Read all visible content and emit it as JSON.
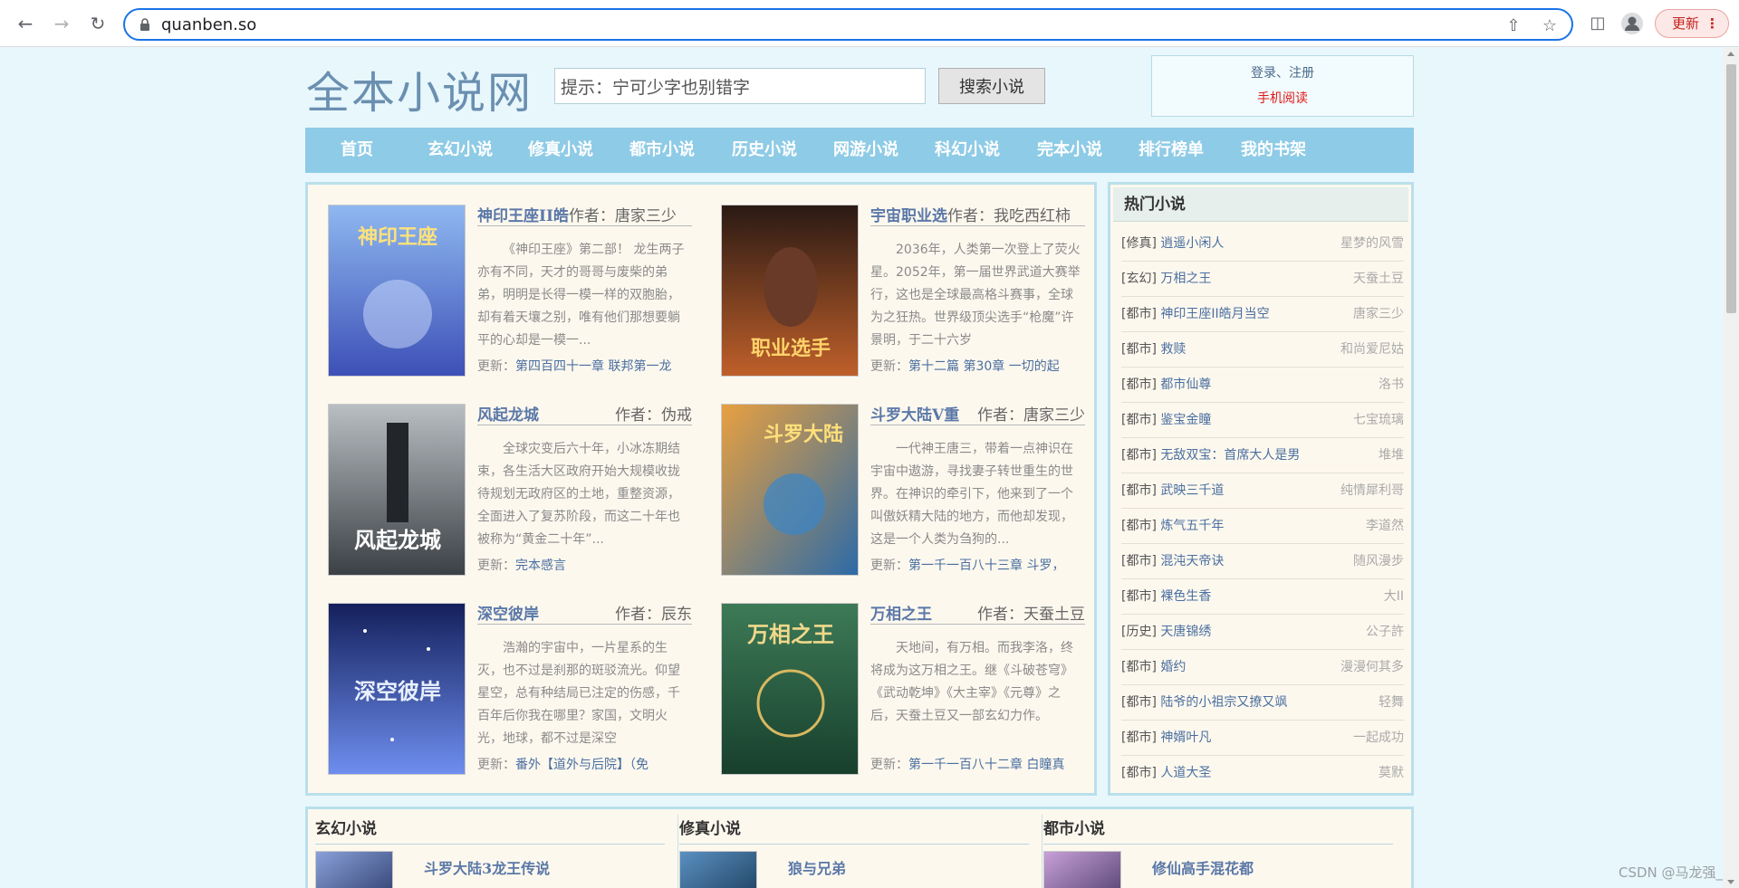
{
  "browser": {
    "url": "quanben.so",
    "update_label": "更新"
  },
  "header": {
    "site_title": "全本小说网",
    "search_value": "提示：宁可少字也别错字",
    "search_button": "搜索小说",
    "login_links": "登录、注册",
    "mobile_link": "手机阅读"
  },
  "nav": [
    {
      "label": "首页"
    },
    {
      "label": "玄幻小说"
    },
    {
      "label": "修真小说"
    },
    {
      "label": "都市小说"
    },
    {
      "label": "历史小说"
    },
    {
      "label": "网游小说"
    },
    {
      "label": "科幻小说"
    },
    {
      "label": "完本小说"
    },
    {
      "label": "排行榜单"
    },
    {
      "label": "我的书架"
    }
  ],
  "featured": [
    {
      "title": "神印王座II皓",
      "author": "作者：唐家三少",
      "desc": "《神印王座》第二部！ 龙生两子亦有不同，天才的哥哥与废柴的弟弟，明明是长得一模一样的双胞胎，却有着天壤之别，唯有他们那想要躺平的心却是一模一...",
      "update_label": "更新：",
      "update": "第四百四十一章 联邦第一龙",
      "cover_title": "神印王座",
      "cover_colors": [
        "#3c4fb6",
        "#8fb8f0"
      ]
    },
    {
      "title": "宇宙职业选",
      "author": "作者：我吃西红柿",
      "desc": "2036年，人类第一次登上了荧火星。2052年，第一届世界武道大赛举行，这也是全球最高格斗赛事，全球为之狂热。世界级顶尖选手“枪魔”许景明，于二十六岁",
      "update_label": "更新：",
      "update": "第十二篇 第30章 一切的起",
      "cover_title": "职业选手",
      "cover_colors": [
        "#2a1a14",
        "#c0602a"
      ]
    },
    {
      "title": "风起龙城",
      "author": "作者：伪戒",
      "desc": "全球灾变后六十年，小冰冻期结束，各生活大区政府开始大规模收拢待规划无政府区的土地，重整资源，全面进入了复苏阶段，而这二十年也被称为“黄金二十年”...",
      "update_label": "更新：",
      "update": "完本感言",
      "cover_title": "风起龙城",
      "cover_colors": [
        "#3a3f44",
        "#b9bec3"
      ]
    },
    {
      "title": "斗罗大陆V重",
      "author": "作者：唐家三少",
      "desc": "一代神王唐三，带着一点神识在宇宙中遨游，寻找妻子转世重生的世界。在神识的牵引下，他来到了一个叫傲妖精大陆的地方，而他却发现，这是一个人类为刍狗的...",
      "update_label": "更新：",
      "update": "第一千一百八十三章 斗罗，",
      "cover_title": "斗罗大陆",
      "cover_colors": [
        "#2b6aa8",
        "#e8a040"
      ]
    },
    {
      "title": "深空彼岸",
      "author": "作者：辰东",
      "desc": "浩瀚的宇宙中，一片星系的生灭，也不过是刹那的斑驳流光。仰望星空，总有种结局已注定的伤感，千百年后你我在哪里？家国，文明火光，地球，都不过是深空",
      "update_label": "更新：",
      "update": "番外【道外与后院】（免",
      "cover_title": "深空彼岸",
      "cover_colors": [
        "#14205c",
        "#6f8ff0"
      ]
    },
    {
      "title": "万相之王",
      "author": "作者：天蚕土豆",
      "desc": "天地间，有万相。而我李洛，终将成为这万相之王。继《斗破苍穹》《武动乾坤》《大主宰》《元尊》之后，天蚕土豆又一部玄幻力作。",
      "update_label": "更新：",
      "update": "第一千一百八十二章 白瞳真",
      "cover_title": "万相之王",
      "cover_colors": [
        "#173f2c",
        "#3d7a57"
      ]
    }
  ],
  "hot": {
    "title": "热门小说",
    "items": [
      {
        "cat": "[修真]",
        "name": "逍遥小闲人",
        "author": "星梦的风雪"
      },
      {
        "cat": "[玄幻]",
        "name": "万相之王",
        "author": "天蚕土豆"
      },
      {
        "cat": "[都市]",
        "name": "神印王座II皓月当空",
        "author": "唐家三少"
      },
      {
        "cat": "[都市]",
        "name": "救赎",
        "author": "和尚爱尼姑"
      },
      {
        "cat": "[都市]",
        "name": "都市仙尊",
        "author": "洛书"
      },
      {
        "cat": "[都市]",
        "name": "鉴宝金瞳",
        "author": "七宝琉璃"
      },
      {
        "cat": "[都市]",
        "name": "无敌双宝：首席大人是男",
        "author": "堆堆"
      },
      {
        "cat": "[都市]",
        "name": "武映三千道",
        "author": "纯情犀利哥"
      },
      {
        "cat": "[都市]",
        "name": "炼气五千年",
        "author": "李道然"
      },
      {
        "cat": "[都市]",
        "name": "混沌天帝诀",
        "author": "随风漫步"
      },
      {
        "cat": "[都市]",
        "name": "裸色生香",
        "author": "大II"
      },
      {
        "cat": "[历史]",
        "name": "天唐锦绣",
        "author": "公子許"
      },
      {
        "cat": "[都市]",
        "name": "婚约",
        "author": "漫漫何其多"
      },
      {
        "cat": "[都市]",
        "name": "陆爷的小祖宗又撩又飒",
        "author": "轻舞"
      },
      {
        "cat": "[都市]",
        "name": "神婿叶凡",
        "author": "一起成功"
      },
      {
        "cat": "[都市]",
        "name": "人道大圣",
        "author": "莫默"
      }
    ]
  },
  "categories": [
    {
      "title": "玄幻小说",
      "book": "斗罗大陆3龙王传说",
      "cover_colors": [
        "#2a3a6a",
        "#8aa0d8"
      ]
    },
    {
      "title": "修真小说",
      "book": "狼与兄弟",
      "cover_colors": [
        "#1a3a5a",
        "#5a90c0"
      ]
    },
    {
      "title": "都市小说",
      "book": "修仙高手混花都",
      "cover_colors": [
        "#4a3a6a",
        "#c8a0d8"
      ]
    }
  ],
  "watermark": "CSDN @马龙强_",
  "colors": {
    "accent_nav": "#8ecbe6",
    "link": "#5a78a8",
    "mobile": "#e21818"
  }
}
